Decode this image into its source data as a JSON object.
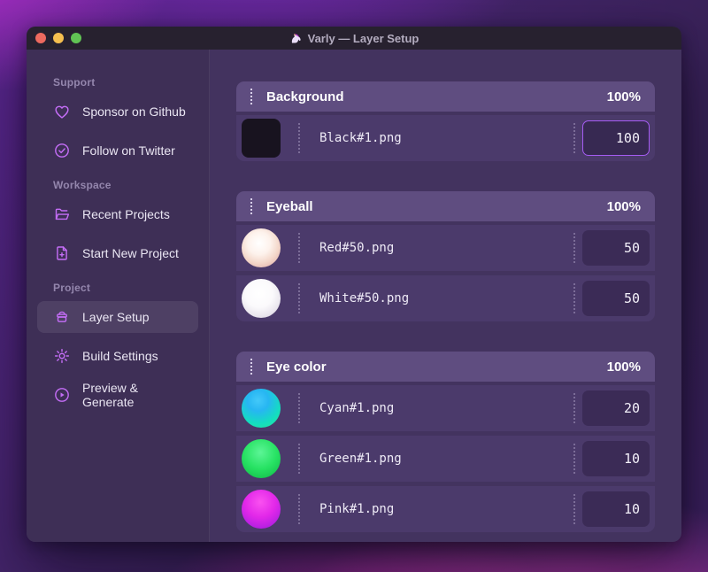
{
  "window": {
    "title": "Varly — Layer Setup",
    "app_icon": "unicorn-icon",
    "traffic_lights": {
      "close": "#ed6a5f",
      "minimize": "#f5bf4f",
      "zoom": "#61c454"
    }
  },
  "sidebar": {
    "sections": [
      {
        "label": "Support",
        "items": [
          {
            "label": "Sponsor on Github",
            "icon": "heart-icon"
          },
          {
            "label": "Follow on Twitter",
            "icon": "verified-badge-icon"
          }
        ]
      },
      {
        "label": "Workspace",
        "items": [
          {
            "label": "Recent Projects",
            "icon": "folder-open-icon"
          },
          {
            "label": "Start New Project",
            "icon": "file-plus-icon"
          }
        ]
      },
      {
        "label": "Project",
        "items": [
          {
            "label": "Layer Setup",
            "icon": "layers-archive-icon",
            "active": true
          },
          {
            "label": "Build Settings",
            "icon": "gear-icon"
          },
          {
            "label": "Preview & Generate",
            "icon": "play-circle-icon"
          }
        ]
      }
    ]
  },
  "layers": {
    "groups": [
      {
        "name": "Background",
        "opacity": "100%",
        "rows": [
          {
            "file": "Black#1.png",
            "value": "100",
            "thumb": "black-square",
            "focused": true
          }
        ]
      },
      {
        "name": "Eyeball",
        "opacity": "100%",
        "rows": [
          {
            "file": "Red#50.png",
            "value": "50",
            "thumb": "red-sphere"
          },
          {
            "file": "White#50.png",
            "value": "50",
            "thumb": "white-sphere"
          }
        ]
      },
      {
        "name": "Eye color",
        "opacity": "100%",
        "rows": [
          {
            "file": "Cyan#1.png",
            "value": "20",
            "thumb": "cyan-sphere"
          },
          {
            "file": "Green#1.png",
            "value": "10",
            "thumb": "green-sphere"
          },
          {
            "file": "Pink#1.png",
            "value": "10",
            "thumb": "pink-sphere"
          }
        ]
      }
    ]
  },
  "colors": {
    "accent": "#a55cf2",
    "icon_purple": "#c46df6",
    "group_header_bg": "#5f4d80",
    "row_bg": "#4b3a6b",
    "sidebar_bg": "#3e2f56",
    "main_bg": "#43335f",
    "titlebar_bg": "#27212f"
  }
}
